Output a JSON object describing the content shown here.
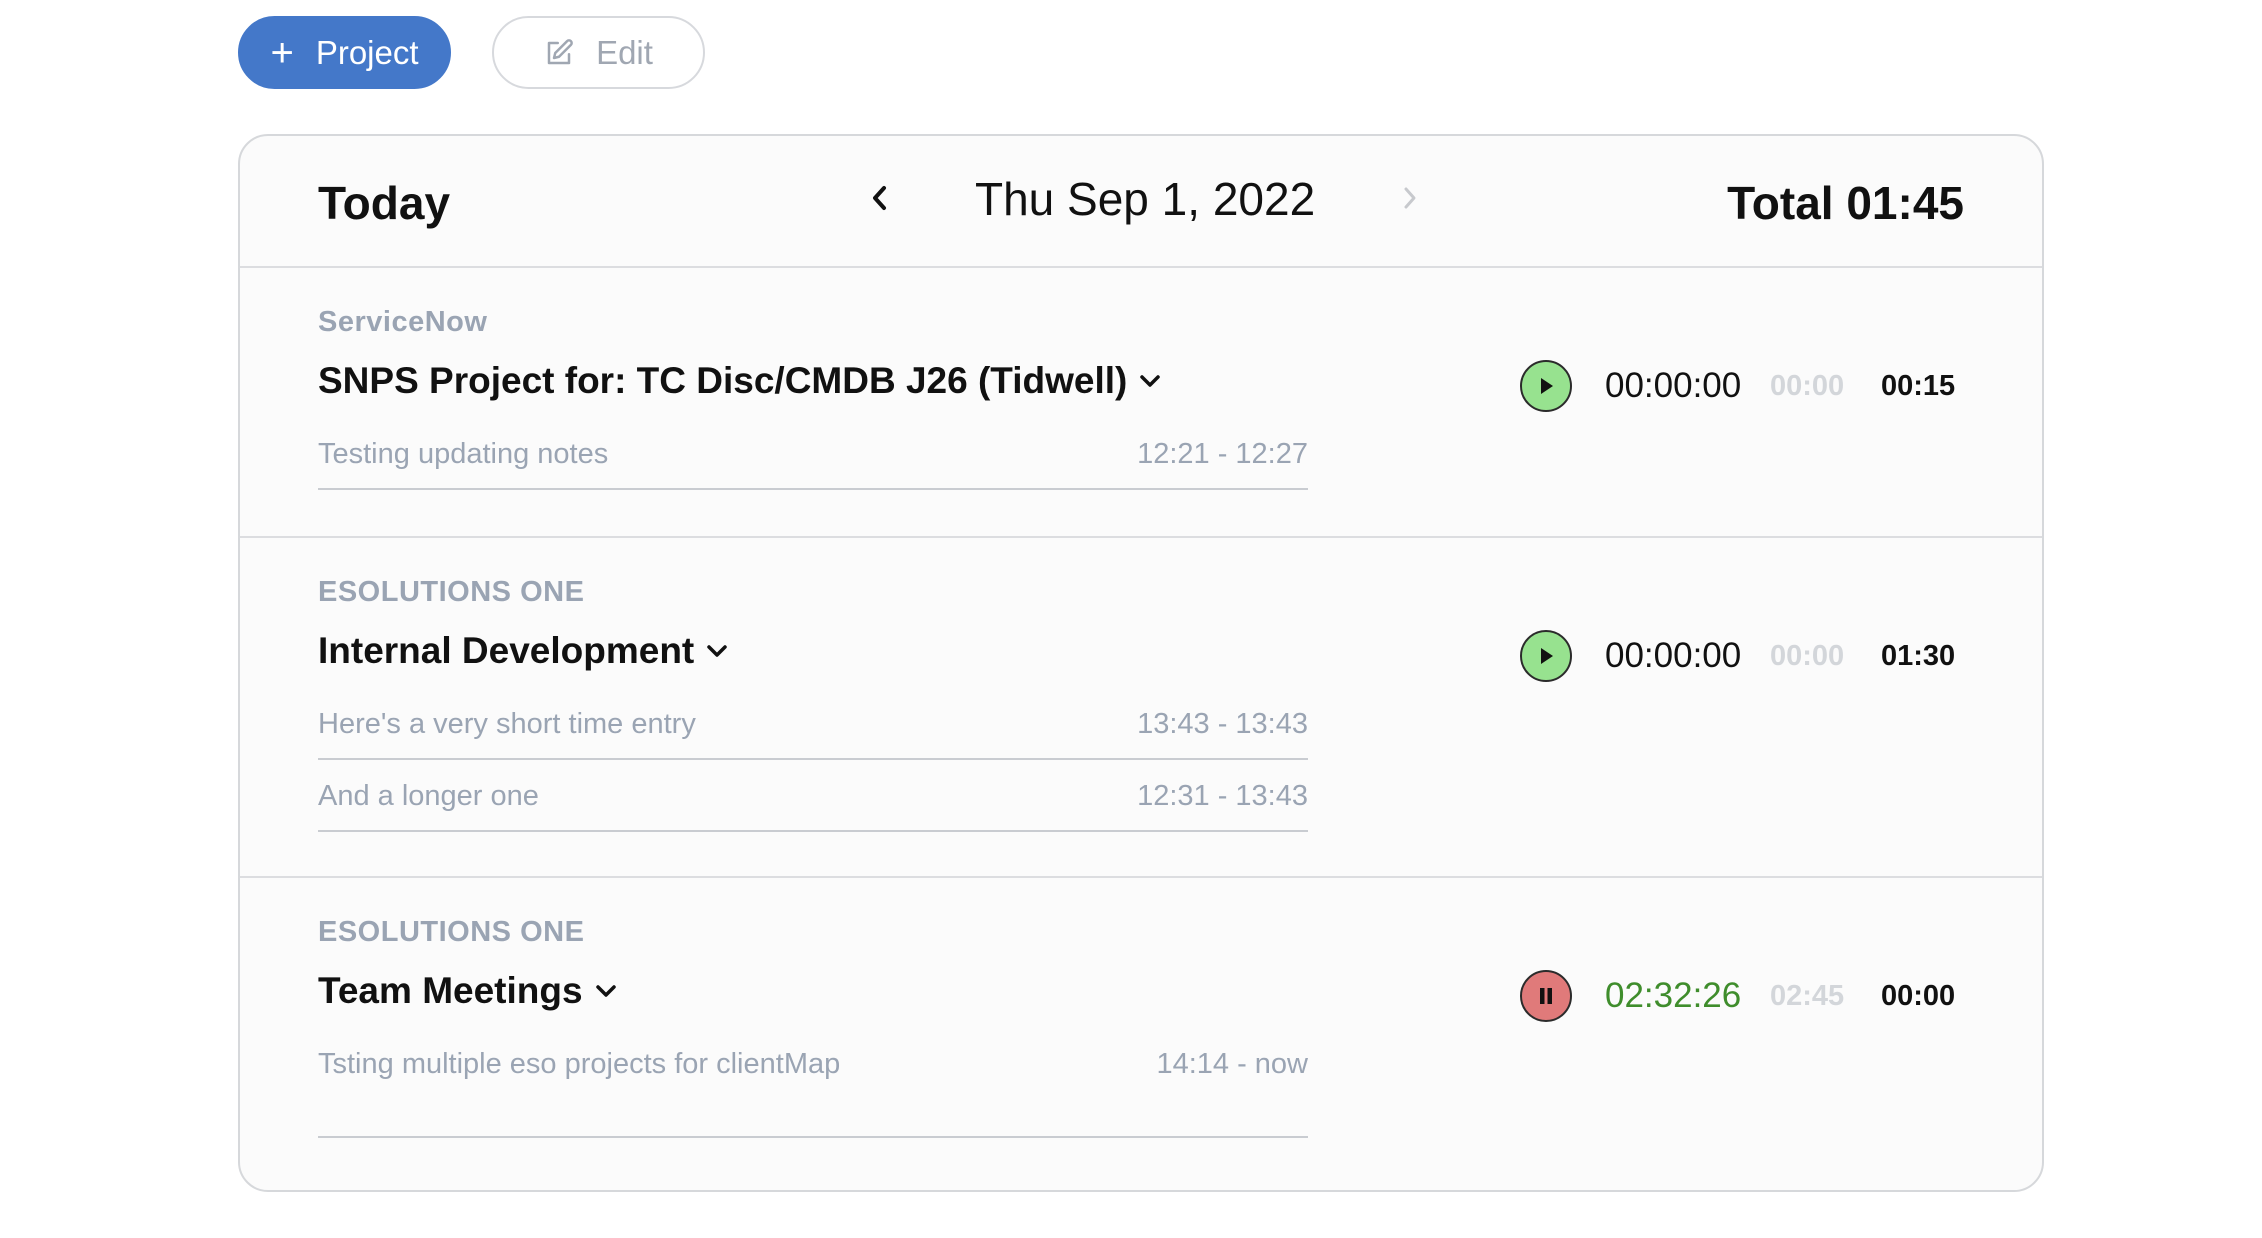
{
  "toolbar": {
    "add_project_label": "Project",
    "add_icon": "plus-icon",
    "edit_label": "Edit",
    "edit_icon": "pencil-square-icon",
    "primary_color": "#4478c9"
  },
  "header": {
    "title": "Today",
    "date": "Thu Sep 1, 2022",
    "total": "Total 01:45",
    "prev_icon": "chevron-left-icon",
    "next_icon": "chevron-right-icon"
  },
  "projects": [
    {
      "client": "ServiceNow",
      "name": "SNPS Project for: TC Disc/CMDB J26 (Tidwell)",
      "timer": "00:00:00",
      "muted_time": "00:00",
      "duration": "00:15",
      "state": "play",
      "entries": [
        {
          "description": "Testing updating notes",
          "range": "12:21 - 12:27"
        }
      ]
    },
    {
      "client": "ESOLUTIONS ONE",
      "name": "Internal Development",
      "timer": "00:00:00",
      "muted_time": "00:00",
      "duration": "01:30",
      "state": "play",
      "entries": [
        {
          "description": "Here's a very short time entry",
          "range": "13:43 - 13:43"
        },
        {
          "description": "And a longer one",
          "range": "12:31 - 13:43"
        }
      ]
    },
    {
      "client": "ESOLUTIONS ONE",
      "name": "Team Meetings",
      "timer": "02:32:26",
      "muted_time": "02:45",
      "duration": "00:00",
      "state": "pause",
      "entries": [
        {
          "description": "Tsting multiple eso projects for clientMap",
          "range": "14:14 - now"
        }
      ]
    }
  ],
  "colors": {
    "play": "#97e28f",
    "pause": "#e07a7a",
    "running_timer": "#3f8d2c",
    "muted": "#9aa4b3"
  }
}
